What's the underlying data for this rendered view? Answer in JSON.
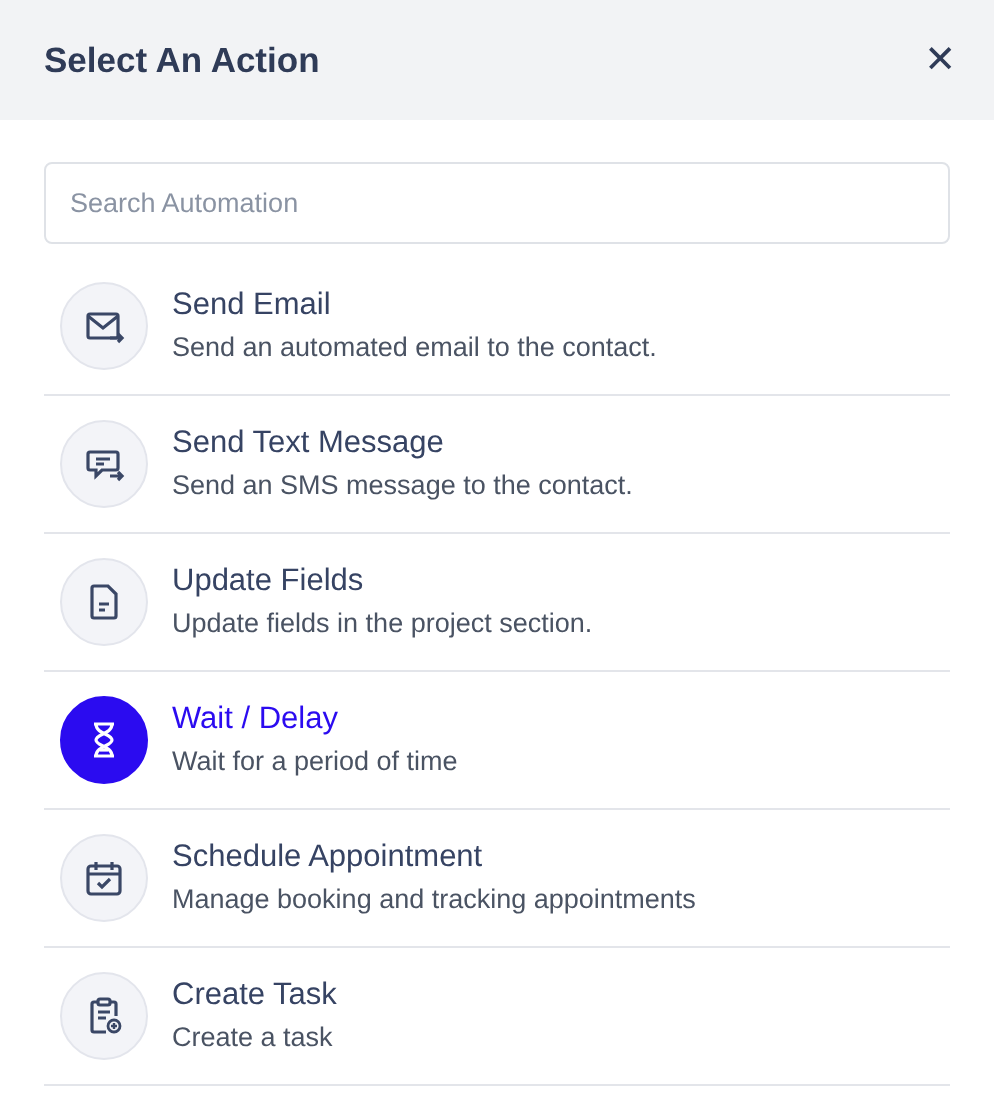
{
  "dialog": {
    "title": "Select An Action",
    "close": "✕"
  },
  "search": {
    "placeholder": "Search Automation"
  },
  "actions": [
    {
      "kind": "email",
      "title": "Send Email",
      "description": "Send an automated email to the contact.",
      "selected": false
    },
    {
      "kind": "sms",
      "title": "Send Text Message",
      "description": "Send an SMS message to the contact.",
      "selected": false
    },
    {
      "kind": "document",
      "title": "Update Fields",
      "description": "Update fields in the project section.",
      "selected": false
    },
    {
      "kind": "hourglass",
      "title": "Wait / Delay",
      "description": "Wait for a period of time",
      "selected": true
    },
    {
      "kind": "calendar",
      "title": "Schedule Appointment",
      "description": "Manage booking and tracking appointments",
      "selected": false
    },
    {
      "kind": "clipboard",
      "title": "Create Task",
      "description": "Create a task",
      "selected": false
    }
  ]
}
